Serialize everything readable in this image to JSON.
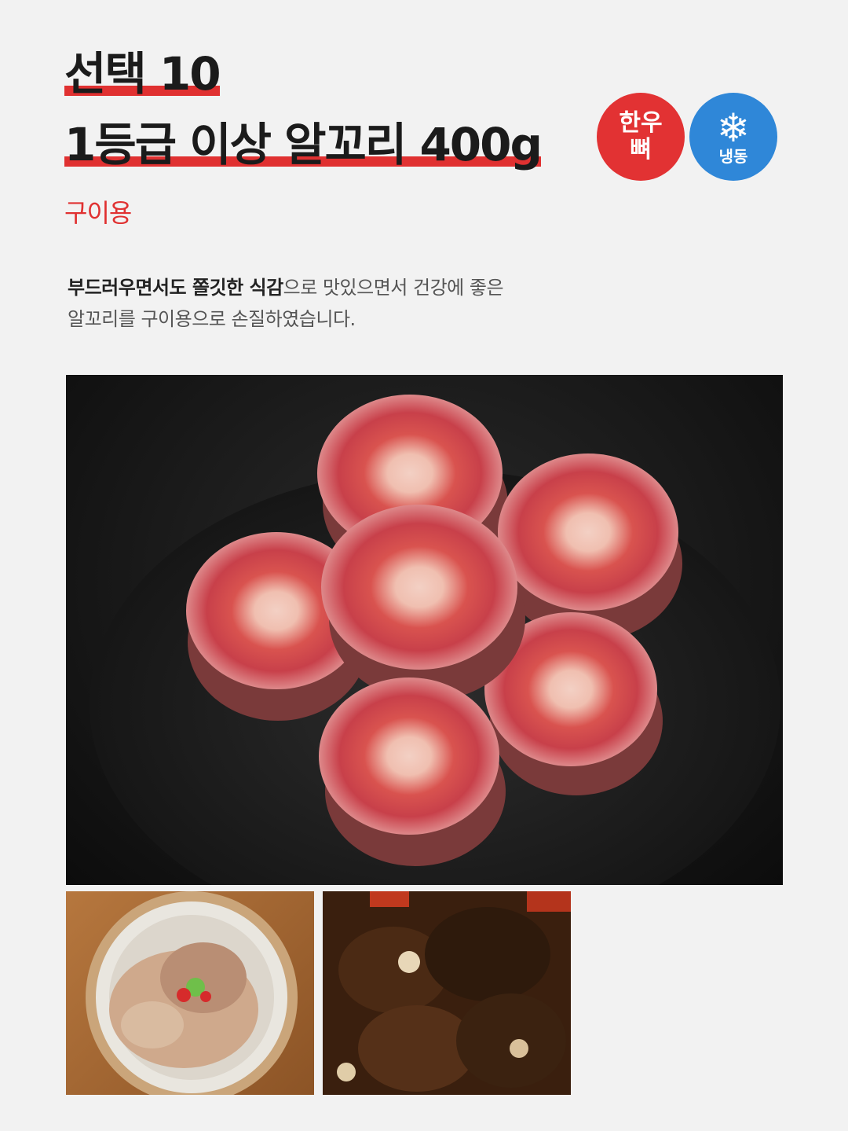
{
  "header": {
    "title_line1": "선택 10",
    "title_line2": "1등급 이상 알꼬리 400g",
    "subtitle": "구이용"
  },
  "badges": {
    "hanwoo_line1": "한우",
    "hanwoo_line2": "뼈",
    "frozen_label": "냉동",
    "hanwoo_color": "#e23233",
    "frozen_color": "#2f87d8",
    "frozen_icon": "snowflake-icon"
  },
  "description": {
    "bold": "부드러우면서도 쫄깃한 식감",
    "rest_line1": "으로 맛있으면서 건강에 좋은",
    "line2": "알꼬리를 구이용으로 손질하였습니다."
  },
  "colors": {
    "accent_red": "#e03131",
    "background": "#f2f2f2"
  }
}
